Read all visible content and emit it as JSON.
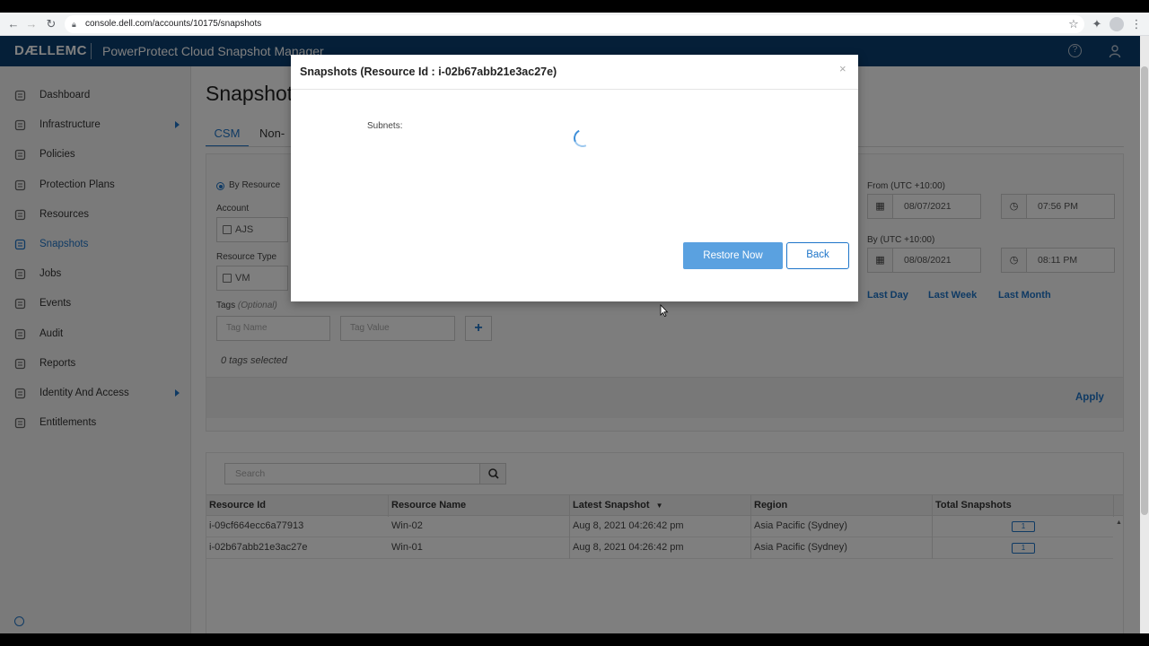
{
  "browser": {
    "url": "console.dell.com/accounts/10175/snapshots"
  },
  "app": {
    "brand": "DÆLLEMC",
    "title": "PowerProtect Cloud Snapshot Manager"
  },
  "sidebar": {
    "items": [
      {
        "label": "Dashboard",
        "icon": "dashboard-icon"
      },
      {
        "label": "Infrastructure",
        "icon": "infrastructure-icon"
      },
      {
        "label": "Policies",
        "icon": "policies-icon"
      },
      {
        "label": "Protection Plans",
        "icon": "protection-plans-icon"
      },
      {
        "label": "Resources",
        "icon": "resources-icon"
      },
      {
        "label": "Snapshots",
        "icon": "camera-icon"
      },
      {
        "label": "Jobs",
        "icon": "jobs-icon"
      },
      {
        "label": "Events",
        "icon": "events-icon"
      },
      {
        "label": "Audit",
        "icon": "audit-icon"
      },
      {
        "label": "Reports",
        "icon": "reports-icon"
      },
      {
        "label": "Identity And Access",
        "icon": "identity-icon"
      },
      {
        "label": "Entitlements",
        "icon": "entitlements-icon"
      }
    ],
    "active_index": 5
  },
  "main": {
    "title": "Snapshot",
    "tabs": [
      "CSM",
      "Non-"
    ],
    "filters": {
      "mode_label": "By Resource",
      "account_label": "Account",
      "account_value": "AJS",
      "resource_type_label": "Resource Type",
      "resource_type_value": "VM",
      "tags_label": "Tags",
      "tags_optional": "(Optional)",
      "tag_name_placeholder": "Tag Name",
      "tag_value_placeholder": "Tag Value",
      "add_tag": "+",
      "tags_selected": "0 tags selected",
      "from_label": "From (UTC +10:00)",
      "from_date": "08/07/2021",
      "from_time": "07:56 PM",
      "by_label": "By (UTC +10:00)",
      "by_date": "08/08/2021",
      "by_time": "08:11 PM",
      "quick_links": [
        "Last Day",
        "Last Week",
        "Last Month"
      ],
      "apply": "Apply"
    },
    "table": {
      "search_placeholder": "Search",
      "columns": [
        "Resource Id",
        "Resource Name",
        "Latest Snapshot",
        "Region",
        "Total Snapshots"
      ],
      "rows": [
        {
          "id": "i-09cf664ecc6a77913",
          "name": "Win-02",
          "latest": "Aug 8, 2021 04:26:42 pm",
          "region": "Asia Pacific (Sydney)",
          "total": "1"
        },
        {
          "id": "i-02b67abb21e3ac27e",
          "name": "Win-01",
          "latest": "Aug 8, 2021 04:26:42 pm",
          "region": "Asia Pacific (Sydney)",
          "total": "1"
        }
      ]
    }
  },
  "modal": {
    "title": "Snapshots (Resource Id : i-02b67abb21e3ac27e)",
    "close": "×",
    "subnets_label": "Subnets:",
    "restore_button": "Restore Now",
    "back_button": "Back"
  },
  "colors": {
    "header_bg": "#0b3e70",
    "accent": "#1e75c9",
    "primary_button": "#5aa1e0"
  }
}
